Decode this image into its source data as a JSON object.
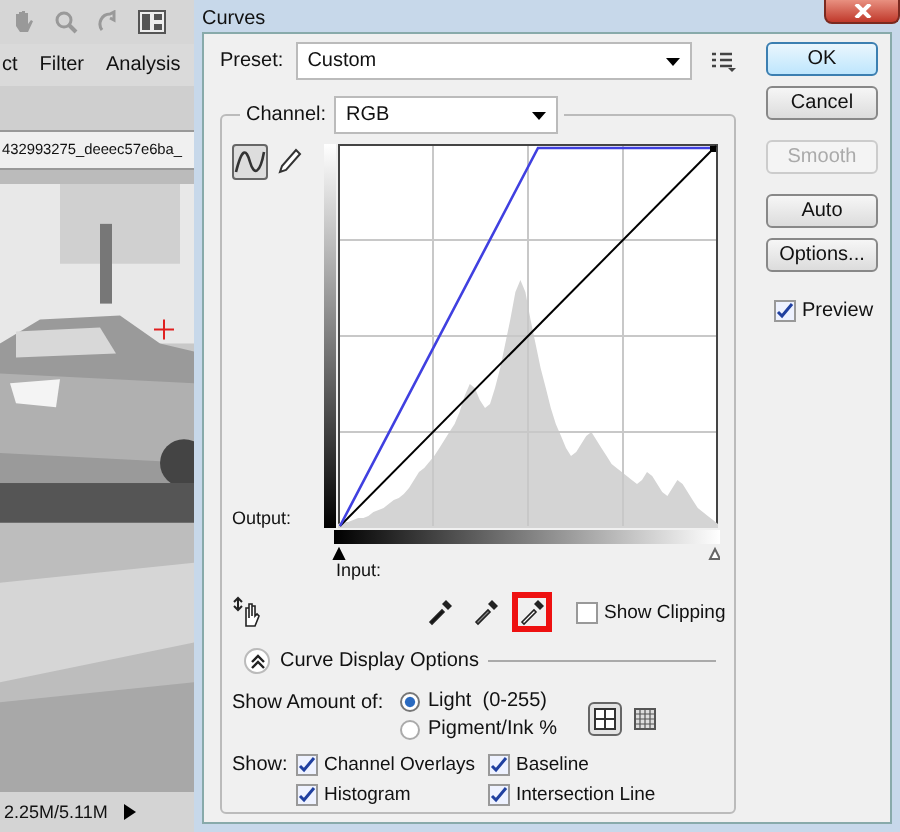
{
  "app": {
    "menu": [
      "ct",
      "Filter",
      "Analysis"
    ],
    "document_tab": "432993275_deeec57e6ba_",
    "status": "2.25M/5.11M"
  },
  "dialog": {
    "title": "Curves",
    "preset": {
      "label": "Preset:",
      "value": "Custom"
    },
    "channel": {
      "label": "Channel:",
      "value": "RGB"
    },
    "curve_tools": [
      {
        "kind": "curve",
        "selected": true
      },
      {
        "kind": "pencil",
        "selected": false
      }
    ],
    "output_label": "Output:",
    "input_label": "Input:",
    "input_sliders": [
      {
        "kind": "shadow",
        "level": 0
      },
      {
        "kind": "highlight",
        "level": 1
      }
    ],
    "eyedroppers": [
      {
        "kind": "black",
        "selected": false
      },
      {
        "kind": "gray",
        "selected": false
      },
      {
        "kind": "white",
        "selected": true
      }
    ],
    "show_clipping": {
      "label": "Show Clipping",
      "checked": false
    },
    "display_options": {
      "title": "Curve Display Options",
      "expanded": true,
      "show_amount_label": "Show Amount of:",
      "amount_options": [
        {
          "label": "Light  (0-255)",
          "selected": true
        },
        {
          "label": "Pigment/Ink %",
          "selected": false
        }
      ],
      "grid_options": [
        {
          "kind": "coarse",
          "selected": true
        },
        {
          "kind": "fine",
          "selected": false
        }
      ],
      "show_label": "Show:",
      "show_options": [
        {
          "label": "Channel Overlays",
          "checked": true
        },
        {
          "label": "Baseline",
          "checked": true
        },
        {
          "label": "Histogram",
          "checked": true
        },
        {
          "label": "Intersection Line",
          "checked": true
        }
      ]
    },
    "buttons": [
      {
        "label": "OK",
        "default": true,
        "disabled": false
      },
      {
        "label": "Cancel",
        "default": false,
        "disabled": false
      },
      {
        "label": "Smooth",
        "default": false,
        "disabled": true
      },
      {
        "label": "Auto",
        "default": false,
        "disabled": false
      },
      {
        "label": "Options...",
        "default": false,
        "disabled": false
      }
    ],
    "preview": {
      "label": "Preview",
      "checked": true
    }
  }
}
